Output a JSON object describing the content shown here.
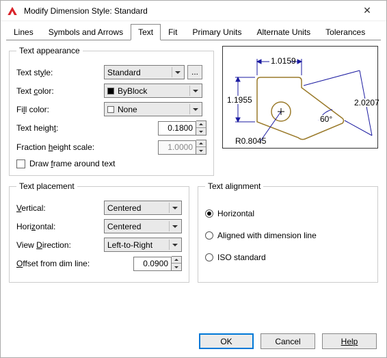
{
  "window": {
    "title": "Modify Dimension Style: Standard"
  },
  "tabs": {
    "lines": "Lines",
    "symbols": "Symbols and Arrows",
    "text": "Text",
    "fit": "Fit",
    "primary": "Primary Units",
    "alternate": "Alternate Units",
    "tolerances": "Tolerances"
  },
  "appearance": {
    "legend": "Text appearance",
    "style_label": "Text style:",
    "style_value": "Standard",
    "color_label": "Text color:",
    "color_value": "ByBlock",
    "fill_label": "Fill color:",
    "fill_value": "None",
    "height_label": "Text height:",
    "height_value": "0.1800",
    "fraction_label": "Fraction height scale:",
    "fraction_value": "1.0000",
    "frame_label": "Draw frame around text"
  },
  "placement": {
    "legend": "Text placement",
    "vertical_label": "Vertical:",
    "vertical_value": "Centered",
    "horizontal_label": "Horizontal:",
    "horizontal_value": "Centered",
    "direction_label": "View Direction:",
    "direction_value": "Left-to-Right",
    "offset_label": "Offset from dim line:",
    "offset_value": "0.0900"
  },
  "alignment": {
    "legend": "Text alignment",
    "horizontal": "Horizontal",
    "aligned": "Aligned with dimension line",
    "iso": "ISO standard"
  },
  "preview": {
    "dim_top": "1.0159",
    "dim_left": "1.1955",
    "dim_right": "2.0207",
    "angle": "60°",
    "radius": "R0.8045"
  },
  "footer": {
    "ok": "OK",
    "cancel": "Cancel",
    "help": "Help"
  }
}
